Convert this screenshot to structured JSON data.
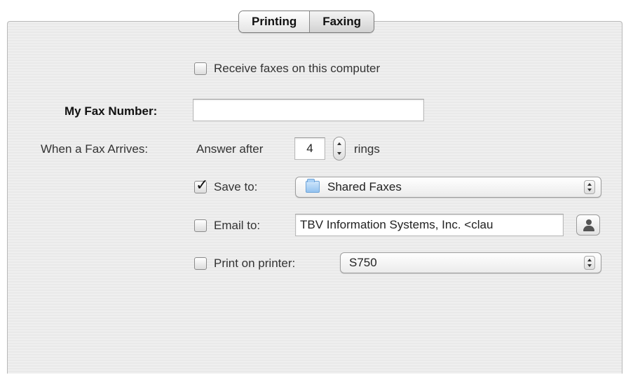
{
  "tabs": [
    {
      "label": "Printing",
      "active": false
    },
    {
      "label": "Faxing",
      "active": true
    }
  ],
  "receive_faxes": {
    "label": "Receive faxes on this computer",
    "checked": false
  },
  "fax_number": {
    "label": "My Fax Number:",
    "value": ""
  },
  "arrival": {
    "label": "When a Fax Arrives:",
    "answer_after_label": "Answer after",
    "rings_value": "4",
    "rings_label": "rings"
  },
  "save_to": {
    "label": "Save to:",
    "checked": true,
    "value": "Shared Faxes",
    "icon": "folder-icon"
  },
  "email_to": {
    "label": "Email to:",
    "checked": false,
    "value": "TBV Information Systems, Inc. <clau",
    "icon": "person-icon"
  },
  "print_on": {
    "label": "Print on printer:",
    "checked": false,
    "value": "S750"
  }
}
